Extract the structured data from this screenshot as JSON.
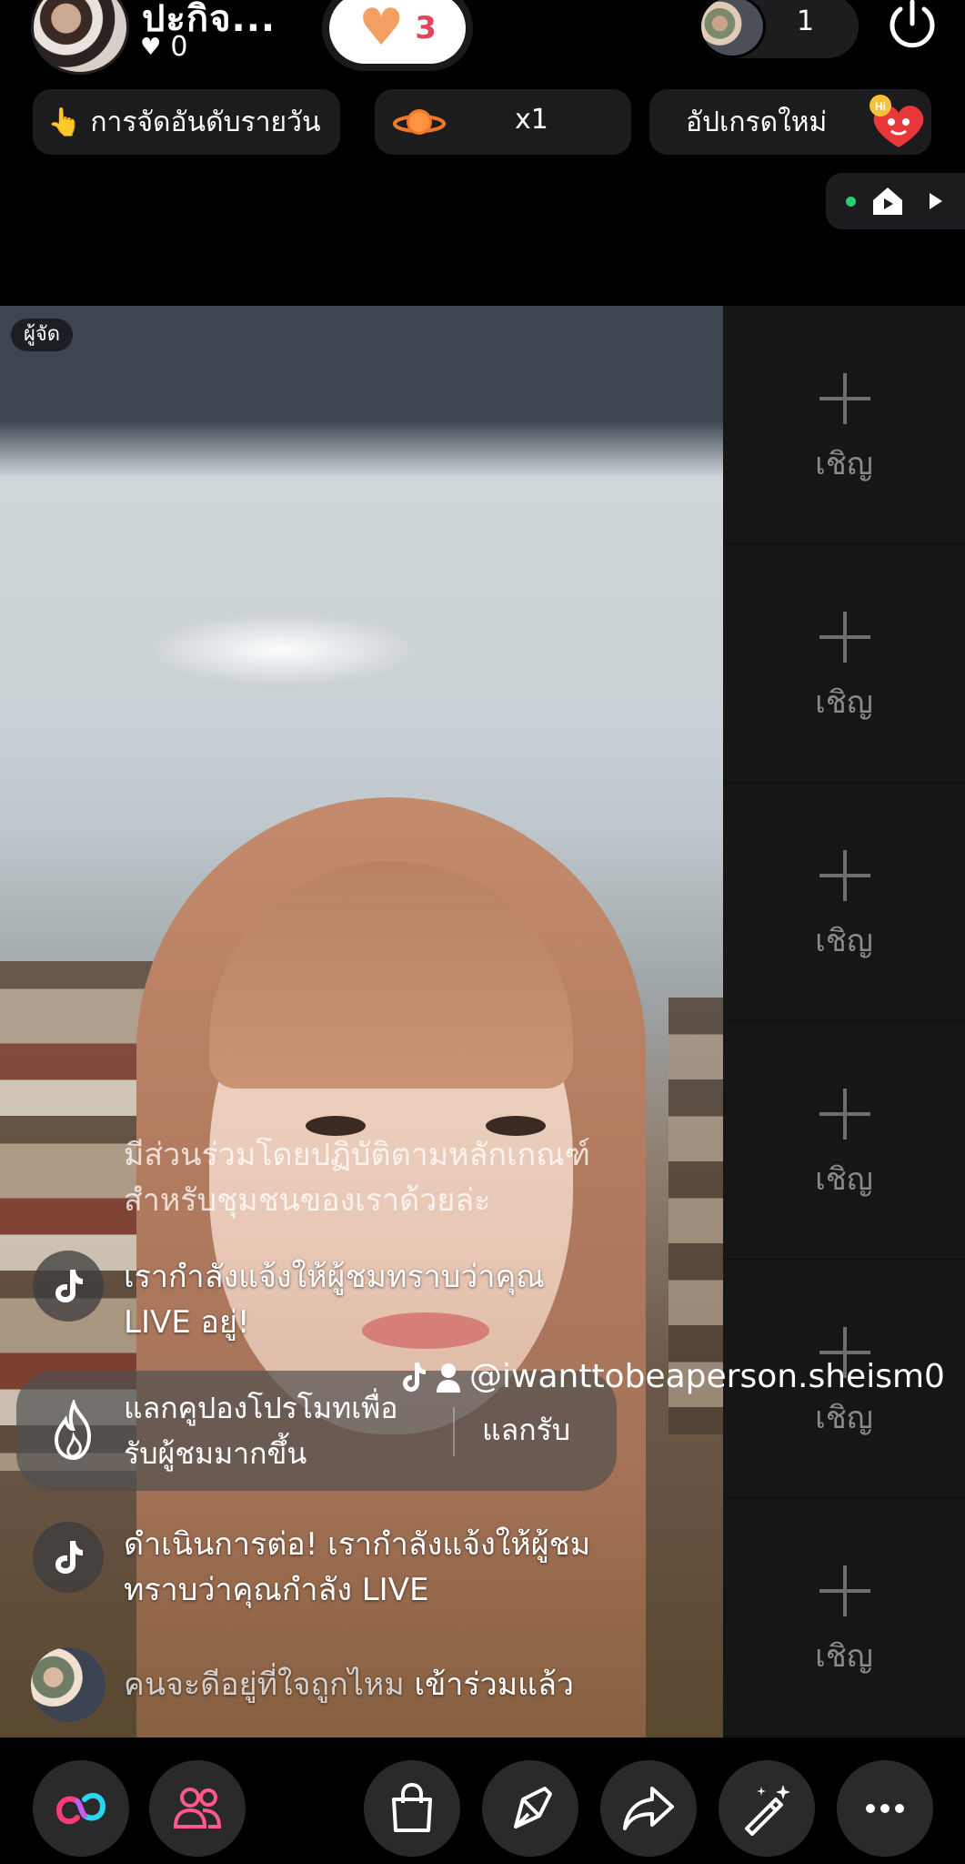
{
  "header": {
    "host_name": "ปะกิจ...",
    "host_likes": "0",
    "follow_count": "3",
    "viewer_count": "1"
  },
  "info_bar": {
    "ranking_label": "การจัดอันดับรายวัน",
    "gift_multiplier": "x1",
    "upgrade_label": "อัปเกรดใหม่",
    "upgrade_badge_text": "Hi"
  },
  "video": {
    "role_badge": "ผู้จัด"
  },
  "invite_slots": [
    {
      "label": "เชิญ"
    },
    {
      "label": "เชิญ"
    },
    {
      "label": "เชิญ"
    },
    {
      "label": "เชิญ"
    },
    {
      "label": "เชิญ"
    },
    {
      "label": "เชิญ"
    }
  ],
  "chat": {
    "faded_line1": "มีส่วนร่วมโดยปฏิบัติตามหลักเกณฑ์",
    "faded_line2": "สำหรับชุมชนของเราด้วยล่ะ",
    "msg1_line1": "เรากำลังแจ้งให้ผู้ชมทราบว่าคุณ",
    "msg1_line2": "LIVE อยู่!",
    "coupon_line1": "แลกคูปองโปรโมทเพื่อ",
    "coupon_line2": "รับผู้ชมมากขึ้น",
    "coupon_button": "แลกรับ",
    "msg2_line1": "ดำเนินการต่อ! เรากำลังแจ้งให้ผู้ชม",
    "msg2_line2": "ทราบว่าคุณกำลัง LIVE",
    "joined_name": "คนจะดีอยู่ที่ใจถูกไหม",
    "joined_suffix": "เข้าร่วมแล้ว"
  },
  "watermark": {
    "handle": "@iwanttobeaperson.sheism0"
  },
  "bottom_bar": [
    "link-icon",
    "guests-icon",
    "shop-icon",
    "effects-icon",
    "share-icon",
    "magic-wand-icon",
    "more-icon"
  ],
  "colors": {
    "accent_pink": "#ff3b78",
    "accent_cyan": "#27d7f0",
    "follow_heart": "#f4a064",
    "follow_count": "#e0455e"
  }
}
